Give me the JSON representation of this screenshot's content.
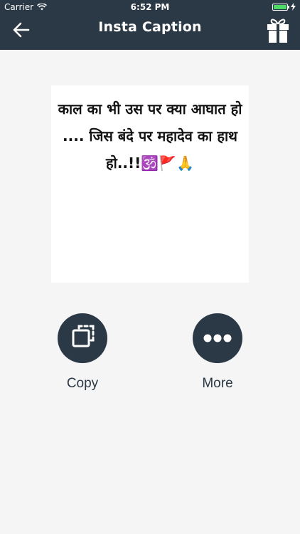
{
  "status_bar": {
    "carrier": "Carrier",
    "time": "6:52 PM"
  },
  "header": {
    "title": "Insta Caption",
    "back_icon": "arrow-left-icon",
    "gift_icon": "gift-icon"
  },
  "caption": {
    "text": "काल का भी उस पर क्या आघात हो .... जिस बंदे पर महादेव का हाथ हो..!!🕉️🚩🙏"
  },
  "actions": {
    "copy_label": "Copy",
    "more_label": "More"
  },
  "colors": {
    "header_bg": "#2b3845",
    "page_bg": "#f5f5f5",
    "card_bg": "#ffffff"
  }
}
